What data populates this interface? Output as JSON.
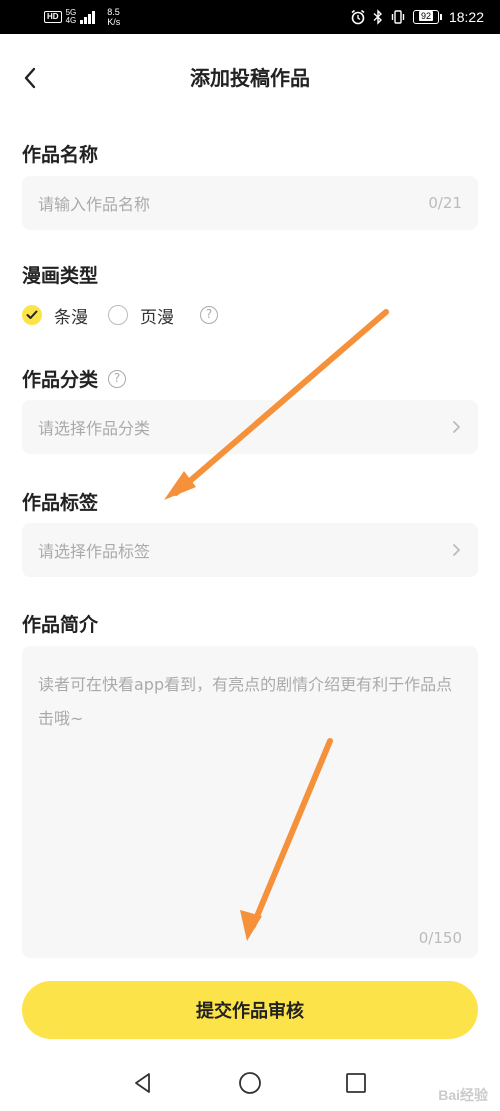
{
  "status_bar": {
    "hd": "HD",
    "net_type_top": "5G",
    "net_type_bottom": "4G",
    "speed_value": "8.5",
    "speed_unit": "K/s",
    "battery": "92",
    "time": "18:22",
    "icons": [
      "alarm-icon",
      "bluetooth-icon",
      "vibrate-icon",
      "battery-icon"
    ]
  },
  "header": {
    "title": "添加投稿作品",
    "back_icon": "chevron-left-icon"
  },
  "form": {
    "name": {
      "label": "作品名称",
      "placeholder": "请输入作品名称",
      "counter": "0/21"
    },
    "comic_type": {
      "label": "漫画类型",
      "options": [
        {
          "label": "条漫",
          "selected": true
        },
        {
          "label": "页漫",
          "selected": false
        }
      ],
      "help_icon": "question-icon"
    },
    "category": {
      "label": "作品分类",
      "placeholder": "请选择作品分类",
      "help_icon": "question-icon"
    },
    "tags": {
      "label": "作品标签",
      "placeholder": "请选择作品标签"
    },
    "intro": {
      "label": "作品简介",
      "placeholder": "读者可在快看app看到，有亮点的剧情介绍更有利于作品点击哦~",
      "counter": "0/150"
    }
  },
  "submit_button": {
    "label": "提交作品审核"
  },
  "nav_bar": {
    "icons": [
      "back-triangle-icon",
      "home-circle-icon",
      "recents-square-icon"
    ]
  },
  "annotation_color": "#f5913a",
  "accent_color": "#fde34a",
  "watermark": "Bai经验"
}
